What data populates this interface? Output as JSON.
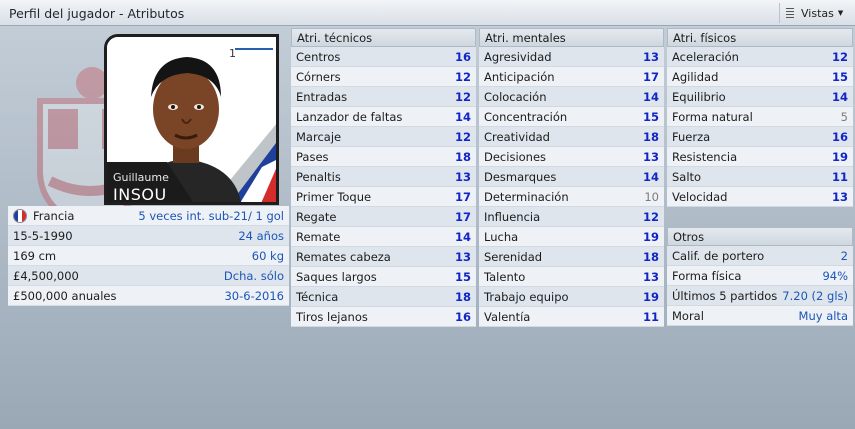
{
  "header": {
    "title": "Perfil del jugador - Atributos",
    "views_label": "Vistas"
  },
  "player": {
    "first_name": "Guillaume",
    "last_name": "INSOU",
    "nationality": "Francia",
    "intl": "5 veces int. sub-21/ 1 gol",
    "dob": "15-5-1990",
    "age": "24 años",
    "height": "169 cm",
    "weight": "60 kg",
    "value": "£4,500,000",
    "foot": "Dcha. sólo",
    "wage": "£500,000 anuales",
    "contract_end": "30-6-2016",
    "flag_colors": [
      "#1f3f9c",
      "#ffffff",
      "#d42b2b"
    ]
  },
  "technical": {
    "title": "Atri. técnicos",
    "rows": [
      {
        "label": "Centros",
        "value": "16"
      },
      {
        "label": "Córners",
        "value": "12"
      },
      {
        "label": "Entradas",
        "value": "12"
      },
      {
        "label": "Lanzador de faltas",
        "value": "14"
      },
      {
        "label": "Marcaje",
        "value": "12"
      },
      {
        "label": "Pases",
        "value": "18"
      },
      {
        "label": "Penaltis",
        "value": "13"
      },
      {
        "label": "Primer Toque",
        "value": "17"
      },
      {
        "label": "Regate",
        "value": "17"
      },
      {
        "label": "Remate",
        "value": "14"
      },
      {
        "label": "Remates cabeza",
        "value": "13"
      },
      {
        "label": "Saques largos",
        "value": "15"
      },
      {
        "label": "Técnica",
        "value": "18"
      },
      {
        "label": "Tiros lejanos",
        "value": "16"
      }
    ]
  },
  "mental": {
    "title": "Atri. mentales",
    "rows": [
      {
        "label": "Agresividad",
        "value": "13"
      },
      {
        "label": "Anticipación",
        "value": "17"
      },
      {
        "label": "Colocación",
        "value": "14"
      },
      {
        "label": "Concentración",
        "value": "15"
      },
      {
        "label": "Creatividad",
        "value": "18"
      },
      {
        "label": "Decisiones",
        "value": "13"
      },
      {
        "label": "Desmarques",
        "value": "14"
      },
      {
        "label": "Determinación",
        "value": "10"
      },
      {
        "label": "Influencia",
        "value": "12"
      },
      {
        "label": "Lucha",
        "value": "19"
      },
      {
        "label": "Serenidad",
        "value": "18"
      },
      {
        "label": "Talento",
        "value": "13"
      },
      {
        "label": "Trabajo equipo",
        "value": "19"
      },
      {
        "label": "Valentía",
        "value": "11"
      }
    ]
  },
  "physical": {
    "title": "Atri. físicos",
    "rows": [
      {
        "label": "Aceleración",
        "value": "12"
      },
      {
        "label": "Agilidad",
        "value": "15"
      },
      {
        "label": "Equilibrio",
        "value": "14"
      },
      {
        "label": "Forma natural",
        "value": "5"
      },
      {
        "label": "Fuerza",
        "value": "16"
      },
      {
        "label": "Resistencia",
        "value": "19"
      },
      {
        "label": "Salto",
        "value": "11"
      },
      {
        "label": "Velocidad",
        "value": "13"
      }
    ]
  },
  "other": {
    "title": "Otros",
    "rows": [
      {
        "label": "Calif. de portero",
        "value": "2"
      },
      {
        "label": "Forma física",
        "value": "94%"
      },
      {
        "label": "Últimos 5 partidos",
        "value": "7.20 (2 gls)"
      },
      {
        "label": "Moral",
        "value": "Muy alta"
      }
    ]
  },
  "colors": {
    "high": "#1226c8",
    "low": "#7c7c7c",
    "link": "#1b55b8"
  }
}
